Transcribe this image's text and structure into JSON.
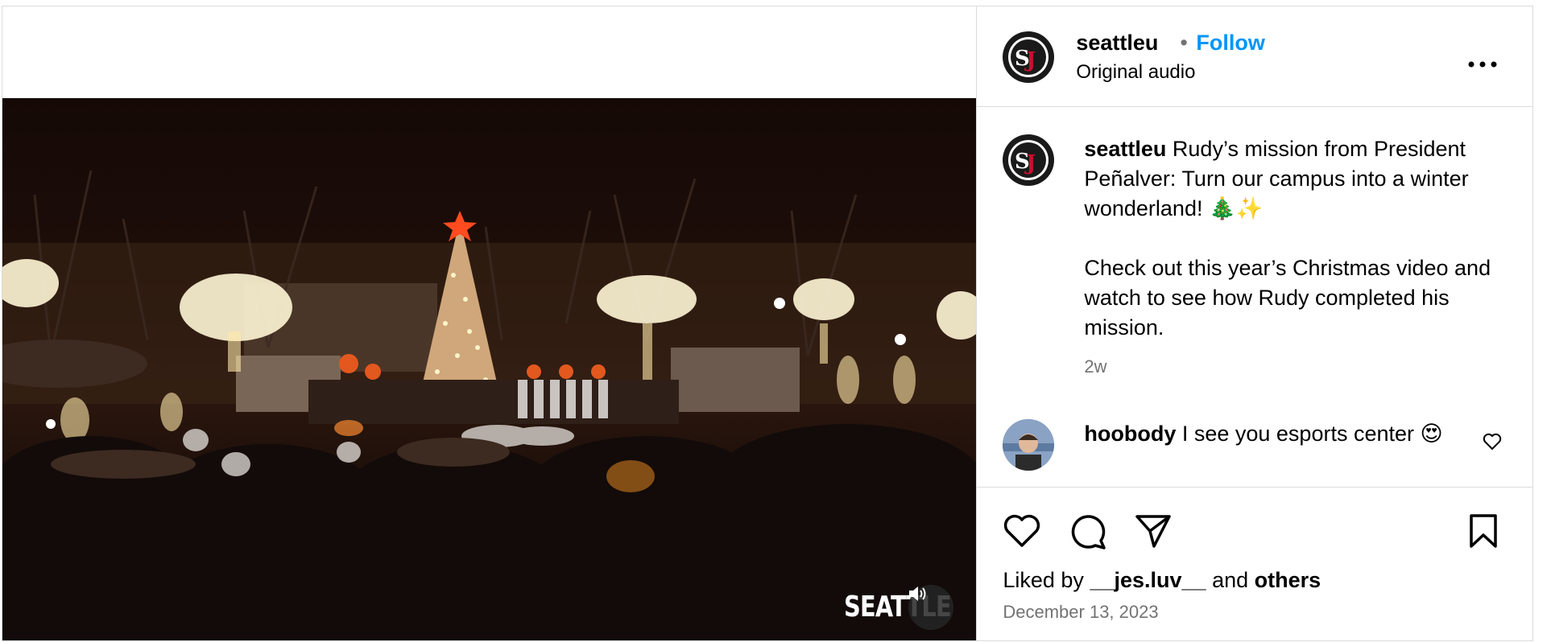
{
  "post": {
    "username": "seattleu",
    "separator": "•",
    "follow_label": "Follow",
    "audio_label": "Original audio",
    "more_label": "...",
    "avatar_text": "SU",
    "video_watermark": "SEATTLE"
  },
  "caption": {
    "username": "seattleu",
    "line1": " Rudy’s mission from President Peñalver: Turn our campus into a winter wonderland! 🎄✨",
    "line2": "Check out this year’s Christmas video and watch to see how Rudy completed his mission.",
    "time": "2w"
  },
  "comment": {
    "username": "hoobody",
    "text": " I see you esports center 😍"
  },
  "likes": {
    "prefix": "Liked by ",
    "user": "__jes.luv__",
    "middle": " and ",
    "others": "others"
  },
  "date": "December 13, 2023",
  "icons": [
    "sound-icon",
    "more-icon",
    "like-icon",
    "comment-icon",
    "share-icon",
    "save-icon",
    "comment-like-icon"
  ],
  "colors": {
    "link": "#0095f6",
    "muted": "#737373",
    "border": "#dbdbdb"
  }
}
